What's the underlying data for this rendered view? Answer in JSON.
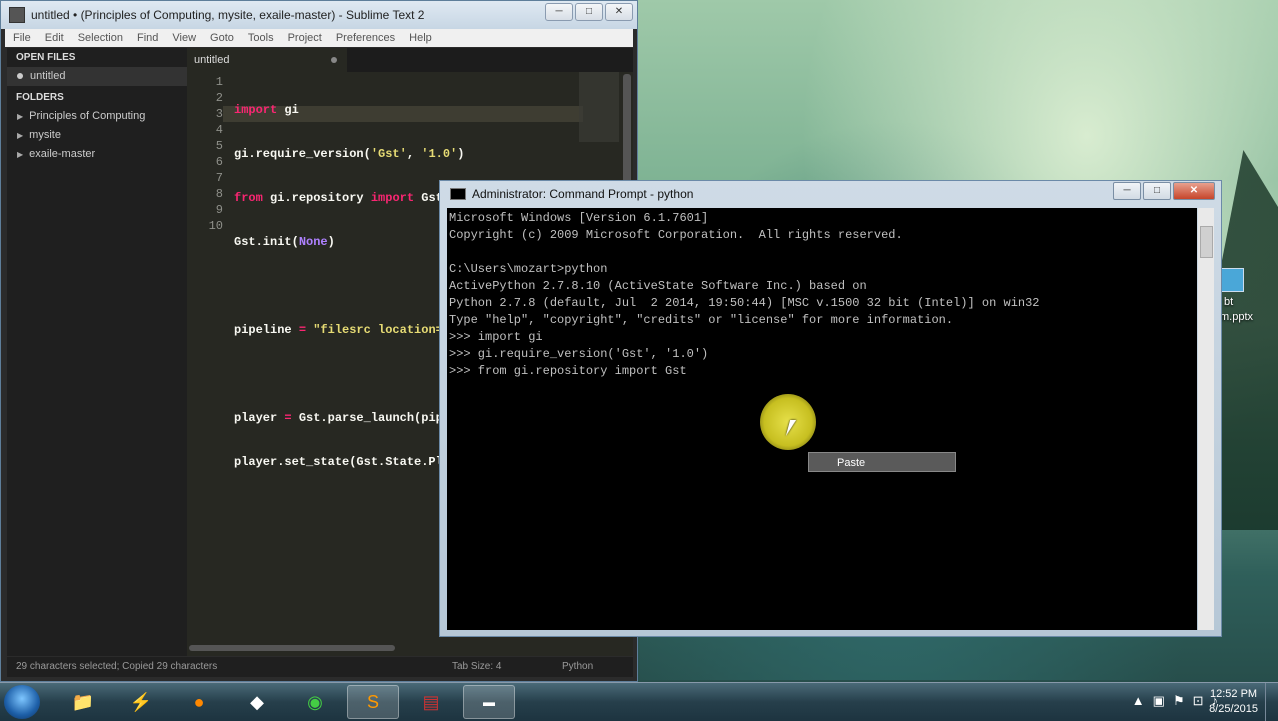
{
  "sublime": {
    "title": "untitled • (Principles of Computing, mysite, exaile-master) - Sublime Text 2",
    "menu": [
      "File",
      "Edit",
      "Selection",
      "Find",
      "View",
      "Goto",
      "Tools",
      "Project",
      "Preferences",
      "Help"
    ],
    "sidebar": {
      "open_files_label": "OPEN FILES",
      "open_files": [
        "untitled"
      ],
      "folders_label": "FOLDERS",
      "folders": [
        "Principles of Computing",
        "mysite",
        "exaile-master"
      ]
    },
    "tab": "untitled",
    "line_numbers": [
      "1",
      "2",
      "3",
      "4",
      "5",
      "6",
      "7",
      "8",
      "9",
      "10"
    ],
    "code": {
      "l1_kw": "import",
      "l1_rest": " gi",
      "l2_a": "gi.require_version(",
      "l2_s1": "'Gst'",
      "l2_b": ", ",
      "l2_s2": "'1.0'",
      "l2_c": ")",
      "l3_kw1": "from",
      "l3_a": " gi.repository ",
      "l3_kw2": "import",
      "l3_b": " Gst",
      "l4_a": "Gst.init(",
      "l4_const": "None",
      "l4_b": ")",
      "l6_a": "pipeline ",
      "l6_op": "=",
      "l6_sp": " ",
      "l6_s": "\"filesrc location=C:/Photograph-Ed_Sl",
      "l8_a": "player ",
      "l8_op": "=",
      "l8_b": " Gst.parse_launch(pip",
      "l9_a": "player.set_state(Gst.State.Pl"
    },
    "status": {
      "selection": "29 characters selected; Copied 29 characters",
      "tab_size": "Tab Size: 4",
      "syntax": "Python"
    }
  },
  "cmd": {
    "title": "Administrator: Command Prompt - python",
    "lines": [
      "Microsoft Windows [Version 6.1.7601]",
      "Copyright (c) 2009 Microsoft Corporation.  All rights reserved.",
      "",
      "C:\\Users\\mozart>python",
      "ActivePython 2.7.8.10 (ActiveState Software Inc.) based on",
      "Python 2.7.8 (default, Jul  2 2014, 19:50:44) [MSC v.1500 32 bit (Intel)] on win32",
      "Type \"help\", \"copyright\", \"credits\" or \"license\" for more information.",
      ">>> import gi",
      ">>> gi.require_version('Gst', '1.0')",
      ">>> from gi.repository import Gst"
    ],
    "context_menu": "Paste"
  },
  "desktop": {
    "icon_label_1": "bt",
    "icon_label_2": "m.pptx"
  },
  "taskbar": {
    "apps": [
      "file-explorer-icon",
      "flash-icon",
      "firefox-icon",
      "foobar-icon",
      "chrome-icon",
      "sublime-icon",
      "pdf-icon",
      "cmd-icon"
    ],
    "time": "12:52 PM",
    "date": "8/25/2015"
  }
}
